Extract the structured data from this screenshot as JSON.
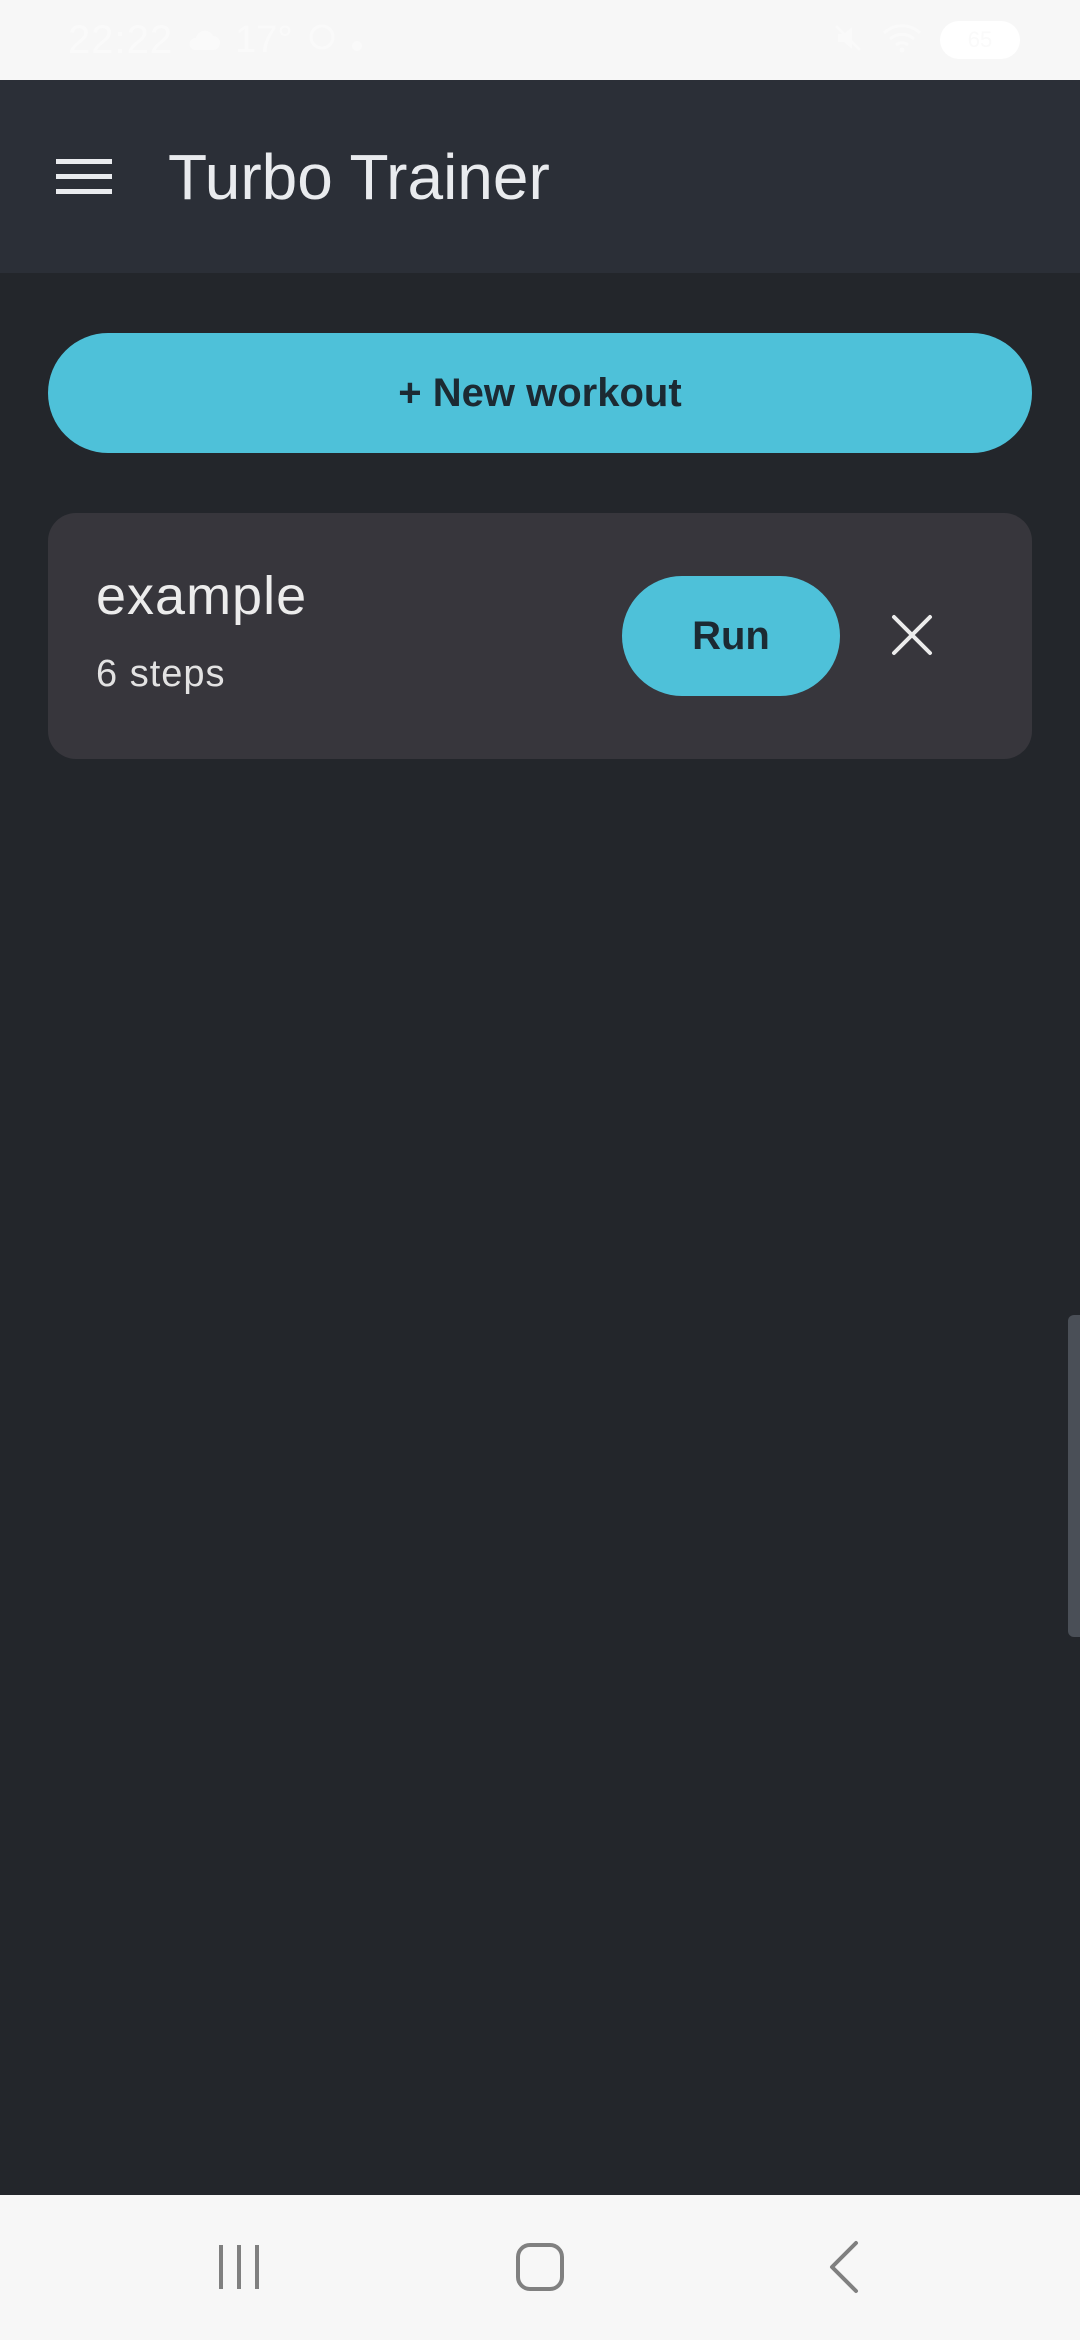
{
  "status_bar": {
    "time": "22:22",
    "temperature": "17°",
    "battery": "65",
    "icons": [
      "cloud-icon",
      "location-icon",
      "dot-icon",
      "mute-icon",
      "wifi-icon",
      "battery-icon"
    ]
  },
  "app_bar": {
    "title": "Turbo Trainer",
    "menu_icon": "hamburger-menu-icon"
  },
  "main": {
    "new_workout_label": "+ New workout",
    "workouts": [
      {
        "name": "example",
        "steps": "6 steps",
        "run_label": "Run",
        "delete_icon": "close-icon"
      }
    ]
  },
  "nav_bar": {
    "icons": [
      "recents-icon",
      "home-icon",
      "back-icon"
    ]
  },
  "colors": {
    "accent": "#4ec1d9",
    "background": "#23262b",
    "app_bar": "#2b2f37",
    "card": "#37363c"
  }
}
